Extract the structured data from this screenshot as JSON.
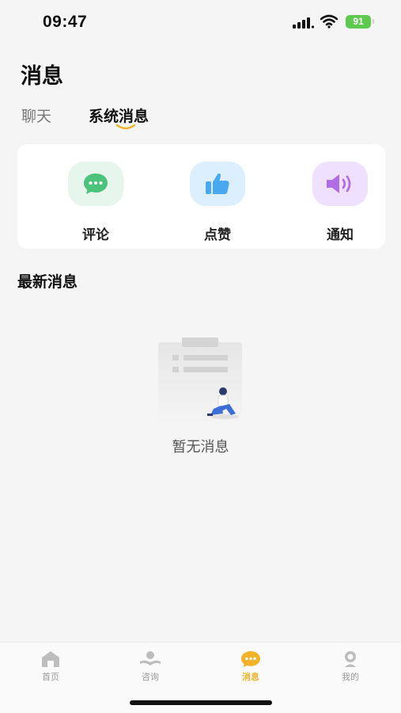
{
  "status_bar": {
    "time": "09:47",
    "battery": "91"
  },
  "header": {
    "title": "消息",
    "tabs": [
      {
        "label": "聊天",
        "active": false
      },
      {
        "label": "系统消息",
        "active": true
      }
    ]
  },
  "categories": [
    {
      "label": "评论",
      "icon": "chat-bubble-icon",
      "color": "#4cc37a"
    },
    {
      "label": "点赞",
      "icon": "thumbs-up-icon",
      "color": "#4aa8f0"
    },
    {
      "label": "通知",
      "icon": "speaker-icon",
      "color": "#b06ee8"
    }
  ],
  "latest": {
    "title": "最新消息",
    "empty_text": "暂无消息"
  },
  "bottom_nav": {
    "active": "消息",
    "accent": "#f2b328",
    "items": [
      {
        "label": "首页",
        "icon": "home-icon"
      },
      {
        "label": "咨询",
        "icon": "consult-icon"
      },
      {
        "label": "消息",
        "icon": "message-icon"
      },
      {
        "label": "我的",
        "icon": "profile-icon"
      }
    ]
  }
}
